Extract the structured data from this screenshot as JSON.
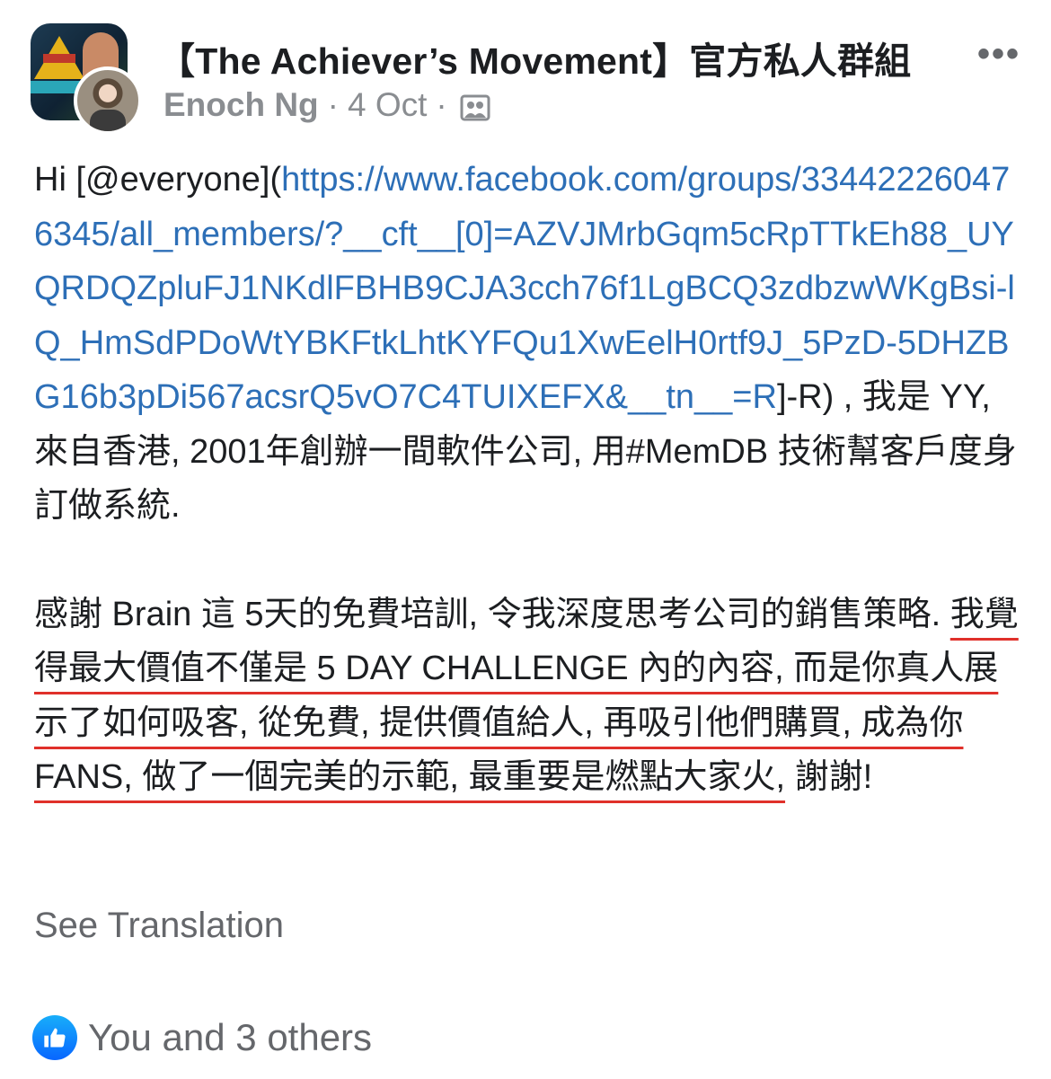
{
  "header": {
    "group_name": "【The Achiever’s Movement】官方私人群組",
    "author": "Enoch Ng",
    "separator": "·",
    "date": "4 Oct",
    "audience_icon": "group-audience-icon",
    "more_label": "•••"
  },
  "post": {
    "greeting": "Hi [@everyone](",
    "link_url": "https://www.facebook.com/groups/334422260476345/all_members/?__cft__[0]=AZVJMrbGqm5cRpTTkEh88_UYQRDQZpluFJ1NKdlFBHB9CJA3cch76f1LgBCQ3zdbzwWKgBsi-lQ_HmSdPDoWtYBKFtkLhtKYFQu1XwEelH0rtf9J_5PzD-5DHZBG16b3pDi567acsrQ5vO7C4TUIXEFX&__tn__=R",
    "after_link": "]-R) , 我是 YY, 來自香港, 2001年創辦一間軟件公司, 用#MemDB 技術幫客戶度身訂做系統.",
    "para2_line1": "感謝 Brain 這 5天的免費培訓, 令我深度思考公司的銷售策略.",
    "para2_underlined": "我覺得最大價值不僅是 5 DAY CHALLENGE 內的內容, 而是你真人展示了如何吸客, 從免費, 提供價值給人, 再吸引他們購買, 成為你 FANS, 做了一個完美的示範, 最重要是燃點大家火,",
    "para2_end": " 謝謝!"
  },
  "see_translation": "See Translation",
  "reactions": {
    "icon": "like-icon",
    "text": "You and 3 others"
  },
  "colors": {
    "link": "#2d6fb7",
    "underline_annotation": "#e0302a",
    "like_blue": "#0866ff",
    "meta_gray": "#8a8d91"
  }
}
